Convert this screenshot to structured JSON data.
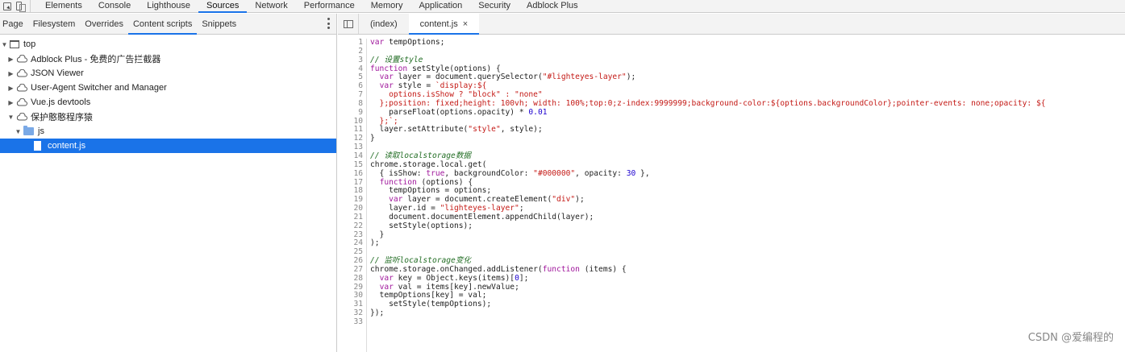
{
  "toolbar": {
    "tabs": [
      "Elements",
      "Console",
      "Lighthouse",
      "Sources",
      "Network",
      "Performance",
      "Memory",
      "Application",
      "Security",
      "Adblock Plus"
    ],
    "active_tab": "Sources"
  },
  "left_panel": {
    "tabs": [
      "Page",
      "Filesystem",
      "Overrides",
      "Content scripts",
      "Snippets"
    ],
    "active_tab": "Content scripts",
    "tree": {
      "root": "top",
      "extensions": [
        "Adblock Plus - 免费的广告拦截器",
        "JSON Viewer",
        "User-Agent Switcher and Manager",
        "Vue.js devtools",
        "保护憨憨程序猿"
      ],
      "folder": "js",
      "file": "content.js"
    }
  },
  "editor": {
    "tabs": [
      "(index)",
      "content.js"
    ],
    "active_tab": "content.js",
    "close_glyph": "×",
    "lines": [
      "var tempOptions;",
      "",
      "// 设置style",
      "function setStyle(options) {",
      "  var layer = document.querySelector(\"#lighteyes-layer\");",
      "  var style = `display:${",
      "    options.isShow ? \"block\" : \"none\"",
      "  };position: fixed;height: 100vh; width: 100%;top:0;z-index:9999999;background-color:${options.backgroundColor};pointer-events: none;opacity: ${",
      "    parseFloat(options.opacity) * 0.01",
      "  };`;",
      "  layer.setAttribute(\"style\", style);",
      "}",
      "",
      "// 读取localstorage数据",
      "chrome.storage.local.get(",
      "  { isShow: true, backgroundColor: \"#000000\", opacity: 30 },",
      "  function (options) {",
      "    tempOptions = options;",
      "    var layer = document.createElement(\"div\");",
      "    layer.id = \"lighteyes-layer\";",
      "    document.documentElement.appendChild(layer);",
      "    setStyle(options);",
      "  }",
      ");",
      "",
      "// 监听localstorage变化",
      "chrome.storage.onChanged.addListener(function (items) {",
      "  var key = Object.keys(items)[0];",
      "  var val = items[key].newValue;",
      "  tempOptions[key] = val;",
      "    setStyle(tempOptions);",
      "});",
      ""
    ]
  },
  "watermark": "CSDN @爱编程的",
  "colors": {
    "accent": "#1a73e8",
    "keyword": "#a0179c",
    "string": "#c41a16",
    "comment": "#236e25",
    "number": "#1c00cf"
  }
}
